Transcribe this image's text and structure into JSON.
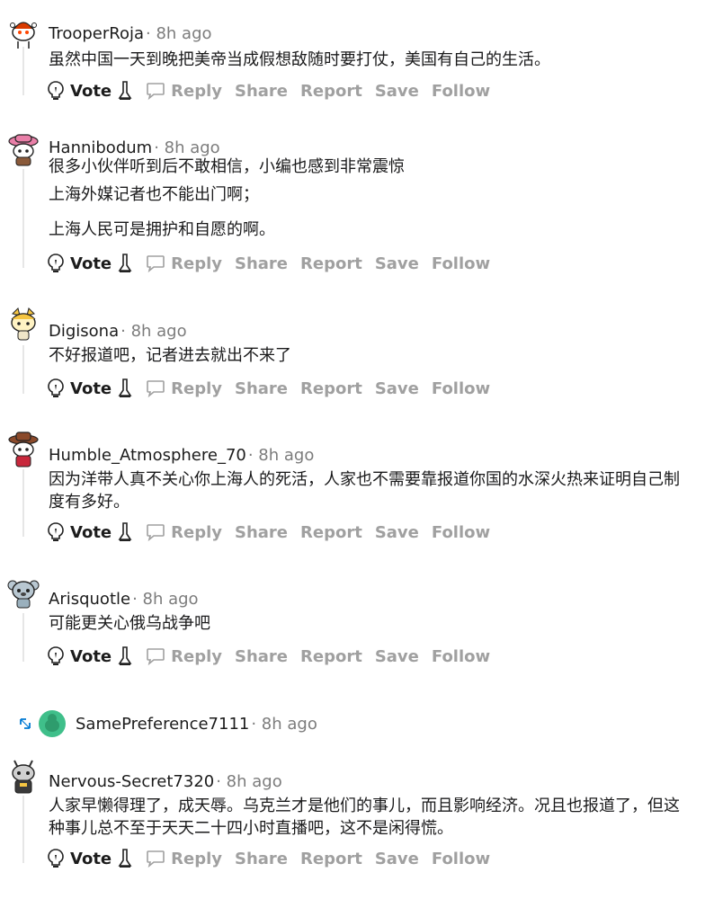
{
  "actions": {
    "vote": "Vote",
    "reply": "Reply",
    "share": "Share",
    "report": "Report",
    "save": "Save",
    "follow": "Follow"
  },
  "comments": [
    {
      "username": "TrooperRoja",
      "meta": "· 8h ago",
      "lines": [
        "虽然中国一天到晚把美帝当成假想敌随时要打仗，美国有自己的生活。"
      ]
    },
    {
      "username": "Hannibodum",
      "meta": "· 8h ago",
      "lines": [
        "很多小伙伴听到后不敢相信，小编也感到非常震惊",
        "上海外媒记者也不能出门啊；",
        "上海人民可是拥护和自愿的啊。"
      ]
    },
    {
      "username": "Digisona",
      "meta": "· 8h ago",
      "lines": [
        "不好报道吧，记者进去就出不来了"
      ]
    },
    {
      "username": "Humble_Atmosphere_70",
      "meta": "· 8h ago",
      "lines": [
        "因为洋带人真不关心你上海人的死活，人家也不需要靠报道你国的水深火热来证明自己制度有多好。"
      ]
    },
    {
      "username": "Arisquotle",
      "meta": "· 8h ago",
      "lines": [
        "可能更关心俄乌战争吧"
      ]
    },
    {
      "username": "SamePreference7111",
      "meta": "· 8h ago",
      "collapsed": true
    },
    {
      "username": "Nervous-Secret7320",
      "meta": "· 8h ago",
      "lines": [
        "人家早懒得理了，成天辱。乌克兰才是他们的事儿，而且影响经济。况且也报道了，但这种事儿总不至于天天二十四小时直播吧，这不是闲得慌。"
      ]
    }
  ],
  "colors": {
    "text": "#1a1a1b",
    "muted": "#a0a0a0",
    "meta": "#7c7c7c",
    "thread_line": "#e6e6e6"
  }
}
